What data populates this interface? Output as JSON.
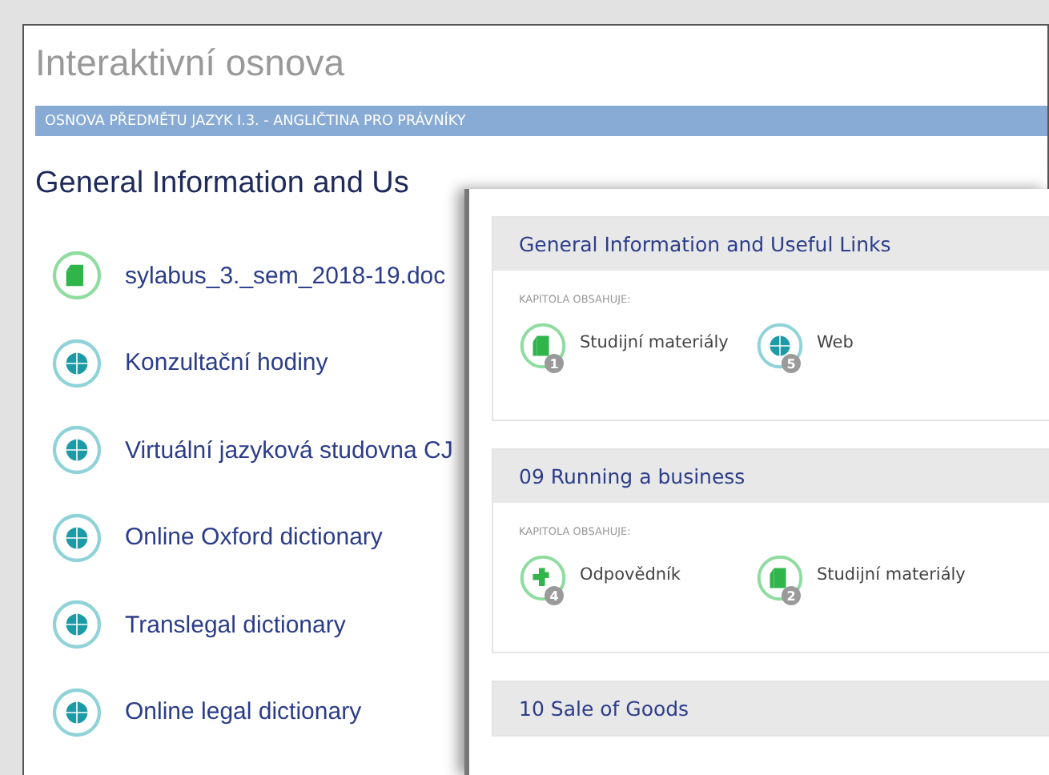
{
  "page": {
    "title": "Interaktivní osnova",
    "banner": "OSNOVA PŘEDMĚTU JAZYK I.3. - ANGLIČTINA PRO PRÁVNÍKY",
    "heading": "General Information and Us"
  },
  "items": [
    {
      "kind": "document",
      "label": "sylabus_3._sem_2018-19.doc"
    },
    {
      "kind": "web",
      "label": "Konzultační hodiny"
    },
    {
      "kind": "web",
      "label": "Virtuální jazyková studovna CJ"
    },
    {
      "kind": "web",
      "label": "Online Oxford dictionary"
    },
    {
      "kind": "web",
      "label": "Translegal dictionary"
    },
    {
      "kind": "web",
      "label": "Online legal dictionary"
    }
  ],
  "chapters": [
    {
      "title": "General Information and Useful Links",
      "contains_label": "KAPITOLA OBSAHUJE:",
      "contents": [
        {
          "kind": "document",
          "label": "Studijní materiály",
          "count": "1"
        },
        {
          "kind": "web",
          "label": "Web",
          "count": "5"
        }
      ]
    },
    {
      "title": "09 Running a business",
      "contains_label": "KAPITOLA OBSAHUJE:",
      "contents": [
        {
          "kind": "quiz",
          "label": "Odpovědník",
          "count": "4"
        },
        {
          "kind": "document",
          "label": "Studijní materiály",
          "count": "2"
        }
      ]
    },
    {
      "title": "10 Sale of Goods"
    }
  ]
}
